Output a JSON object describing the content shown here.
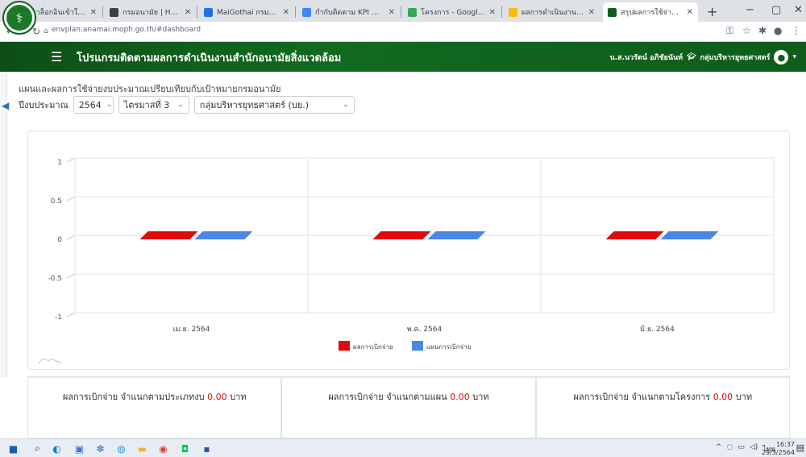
{
  "browser": {
    "tabs": [
      {
        "title": "กรุณาล็อกอินเข้าใช้งาน",
        "color": "#5f6368"
      },
      {
        "title": "กรมอนามัย | Home",
        "color": "#3c4043"
      },
      {
        "title": "MaiGothai กรมอนามัย",
        "color": "#1a73e8"
      },
      {
        "title": "กำกับติดตาม KPI สำนัก",
        "color": "#4285f4"
      },
      {
        "title": "โครงการ - Google ไดรฟ์",
        "color": "#34a853"
      },
      {
        "title": "ผลการดำเนินงานตามแผน",
        "color": "#fbbc04"
      },
      {
        "title": "สรุปผลการใช้จ่ายงบประมาณ",
        "color": "#0f5c1b"
      }
    ],
    "new_tab": "+",
    "url": "envplan.anamai.moph.go.th/#dashboard",
    "window_buttons": [
      "−",
      "▢",
      "✕"
    ]
  },
  "header": {
    "title": "โปรแกรมติดตามผลการดำเนินงานสำนักอนามัยสิ่งแวดล้อม",
    "user": "น.ส.นวรัตน์ อภิชัยนันท์",
    "group": "กลุ่มบริหารยุทธศาสตร์",
    "menu_icon": "hamburger-icon",
    "user_icon": "user-icon"
  },
  "page": {
    "title": "แผนและผลการใช้จ่ายงบประมาณเปรียบเทียบกับเป้าหมายกรมอนามัย",
    "filters": {
      "year_label": "ปีงบประมาณ",
      "year_value": "2564",
      "quarter_value": "ไตรมาสที่ 3",
      "group_value": "กลุ่มบริหารยุทธศาสตร์ (บย.)"
    }
  },
  "chart_data": {
    "type": "bar",
    "categories": [
      "เม.ย. 2564",
      "พ.ค. 2564",
      "มิ.ย. 2564"
    ],
    "series": [
      {
        "name": "ผลการเบิกจ่าย",
        "values": [
          0,
          0,
          0
        ],
        "color": "#e10a0a"
      },
      {
        "name": "แผนการเบิกจ่าย",
        "values": [
          0,
          0,
          0
        ],
        "color": "#4a86e8"
      }
    ],
    "yticks": [
      "1",
      "0.5",
      "0",
      "-0.5",
      "-1"
    ],
    "ylim": [
      -1,
      1
    ],
    "grid": true,
    "legend": "bottom"
  },
  "cards": [
    {
      "label": "ผลการเบิกจ่าย จำแนกตามประเภทงบ",
      "amount": "0.00",
      "unit": "บาท"
    },
    {
      "label": "ผลการเบิกจ่าย จำแนกตามแผน",
      "amount": "0.00",
      "unit": "บาท"
    },
    {
      "label": "ผลการเบิกจ่าย จำแนกตามโครงการ",
      "amount": "0.00",
      "unit": "บาท"
    }
  ],
  "taskbar": {
    "icons": [
      {
        "name": "windows-start-icon",
        "glyph": "■",
        "color": "#1a5fb4"
      },
      {
        "name": "search-icon",
        "glyph": "⌕",
        "color": "#333333"
      },
      {
        "name": "edge-icon",
        "glyph": "◐",
        "color": "#0b84d6"
      },
      {
        "name": "people-icon",
        "glyph": "▣",
        "color": "#3f6fd0"
      },
      {
        "name": "settings-icon",
        "glyph": "✽",
        "color": "#4a90d9"
      },
      {
        "name": "photos-icon",
        "glyph": "◍",
        "color": "#2a9fd6"
      },
      {
        "name": "file-explorer-icon",
        "glyph": "▬",
        "color": "#f2b632"
      },
      {
        "name": "chrome-icon",
        "glyph": "◉",
        "color": "#db4437"
      },
      {
        "name": "line-icon",
        "glyph": "◘",
        "color": "#06c755"
      },
      {
        "name": "word-icon",
        "glyph": "▪",
        "color": "#2b579a"
      }
    ],
    "language": "ไทย",
    "time": "16:37",
    "date": "29/3/2564"
  }
}
